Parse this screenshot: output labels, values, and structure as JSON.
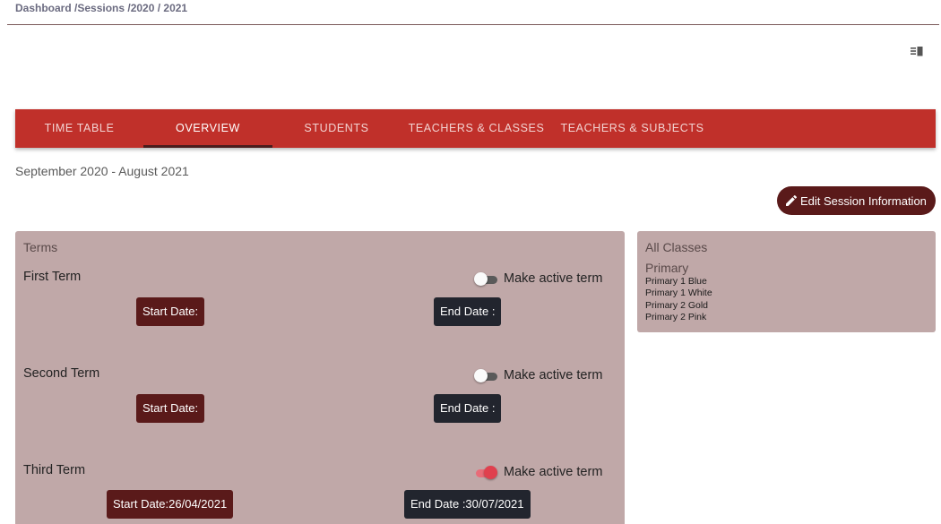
{
  "breadcrumb": "Dashboard /Sessions /2020 / 2021",
  "tabs": [
    {
      "label": "TIME TABLE"
    },
    {
      "label": "OVERVIEW"
    },
    {
      "label": "STUDENTS"
    },
    {
      "label": "TEACHERS & CLASSES"
    },
    {
      "label": "TEACHERS & SUBJECTS"
    }
  ],
  "active_tab": "OVERVIEW",
  "session_range": "September 2020 - August 2021",
  "edit_button_label": "Edit Session Information",
  "terms_panel": {
    "title": "Terms",
    "toggle_label": "Make active term",
    "terms": [
      {
        "name": "First Term",
        "start_label": "Start Date:",
        "end_label": "End Date :",
        "active": false
      },
      {
        "name": "Second Term",
        "start_label": "Start Date:",
        "end_label": "End Date :",
        "active": false
      },
      {
        "name": "Third Term",
        "start_label": "Start Date:26/04/2021",
        "end_label": "End Date :30/07/2021",
        "active": true
      }
    ]
  },
  "classes_panel": {
    "title": "All Classes",
    "group": "Primary",
    "classes": [
      "Primary 1 Blue",
      "Primary 1 White",
      "Primary 2 Gold",
      "Primary 2 Pink"
    ]
  },
  "icons": {
    "view_toggle": "view-columns-icon",
    "edit": "pencil-icon"
  },
  "colors": {
    "tab_bar": "#c0302a",
    "panel": "#c0a8a8",
    "start_chip": "#5a1a1a",
    "end_chip": "#22252e",
    "toggle_active": "#e0404e"
  }
}
